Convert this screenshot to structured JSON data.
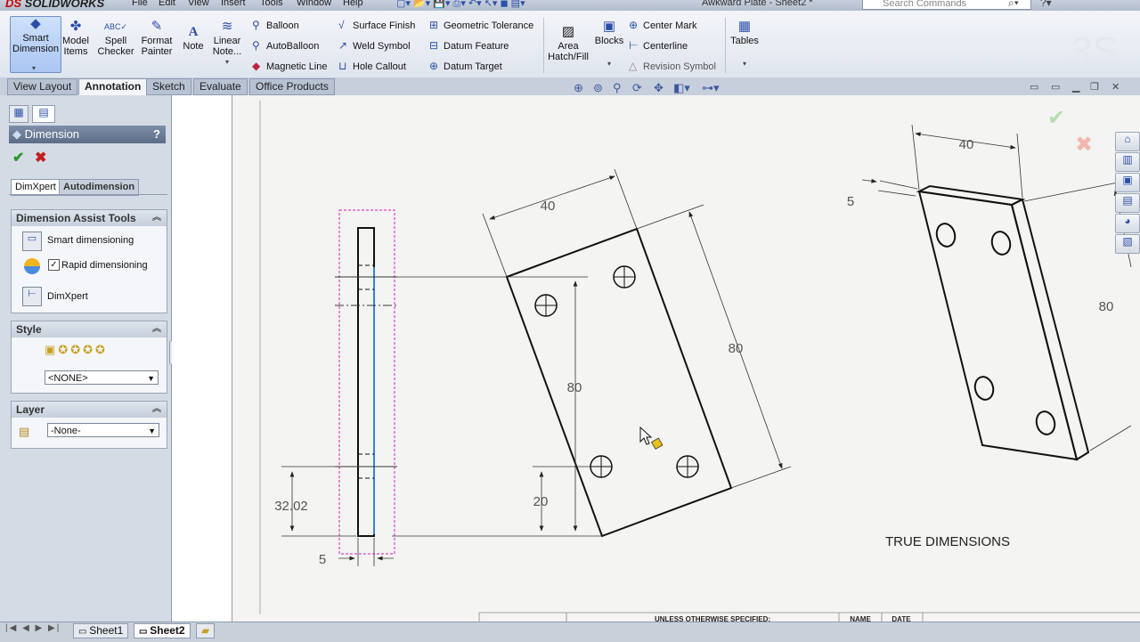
{
  "app": {
    "title": "Awkward Plate - Sheet2 *",
    "search_placeholder": "Search Commands"
  },
  "menu": [
    "File",
    "Edit",
    "View",
    "Insert",
    "Tools",
    "Window",
    "Help"
  ],
  "ribbon": {
    "smart_dimension": "Smart Dimension",
    "model_items": "Model Items",
    "spell_checker": "Spell Checker",
    "format_painter": "Format Painter",
    "note": "Note",
    "linear_note": "Linear Note...",
    "balloon": "Balloon",
    "autoballoon": "AutoBalloon",
    "magnetic_line": "Magnetic Line",
    "surface_finish": "Surface Finish",
    "weld_symbol": "Weld Symbol",
    "hole_callout": "Hole Callout",
    "geometric_tolerance": "Geometric Tolerance",
    "datum_feature": "Datum Feature",
    "datum_target": "Datum Target",
    "area_hatch": "Area Hatch/Fill",
    "blocks": "Blocks",
    "center_mark": "Center Mark",
    "centerline": "Centerline",
    "revision_symbol": "Revision Symbol",
    "tables": "Tables"
  },
  "tabs": [
    "View Layout",
    "Annotation",
    "Sketch",
    "Evaluate",
    "Office Products"
  ],
  "active_tab": "Annotation",
  "panel": {
    "title": "Dimension",
    "help": "?",
    "subtabs": [
      "DimXpert",
      "Autodimension"
    ],
    "assist_header": "Dimension Assist Tools",
    "smart_dimensioning": "Smart dimensioning",
    "rapid_dimensioning": "Rapid dimensioning",
    "rapid_checked": true,
    "dimxpert": "DimXpert",
    "style_header": "Style",
    "style_value": "<NONE>",
    "layer_header": "Layer",
    "layer_value": "-None-"
  },
  "drawing": {
    "side_height": "32.02",
    "side_thickness": "5",
    "rot_width": "40",
    "rot_length": "80",
    "rot_vertical": "80",
    "rot_bottom": "20",
    "iso_width": "40",
    "iso_thickness": "5",
    "iso_length": "80",
    "true_label": "TRUE DIMENSIONS",
    "title_block_text": "UNLESS OTHERWISE SPECIFIED:",
    "name_label": "NAME",
    "date_label": "DATE"
  },
  "sheets": [
    "Sheet1",
    "Sheet2"
  ],
  "active_sheet": "Sheet2",
  "colors": {
    "accent": "#2b4fa8",
    "selection": "#e040c8",
    "highlight_line": "#3c8ee8"
  }
}
